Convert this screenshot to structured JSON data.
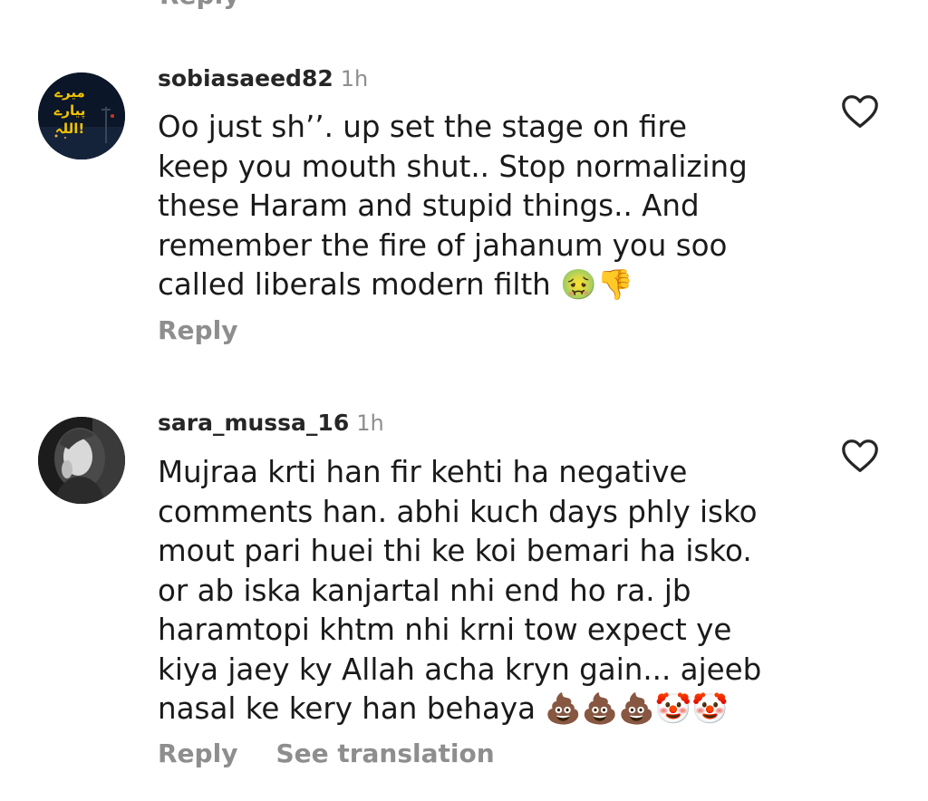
{
  "previous": {
    "reply_fragment": "Reply"
  },
  "comments": [
    {
      "username": "sobiasaeed82",
      "time": "1h",
      "avatar_text": "میرے پیارے اللہ!",
      "text_lines": [
        "Oo just sh’’. up set the stage on fire",
        "keep you mouth shut.. Stop normalizing",
        "these Haram and stupid things.. And",
        "remember the fire of jahanum you soo",
        "called liberals modern filth 🤢👎"
      ],
      "reply_label": "Reply",
      "like_icon": "heart-outline-icon"
    },
    {
      "username": "sara_mussa_16",
      "time": "1h",
      "text_lines": [
        "Mujraa krti han fir kehti ha negative",
        "comments han. abhi kuch days phly isko",
        "mout pari huei thi ke koi bemari ha isko.",
        "or ab iska kanjartal nhi end ho ra. jb",
        "haramtopi khtm nhi krni tow expect ye",
        "kiya jaey ky Allah acha kryn gain... ajeeb",
        "nasal ke kery han behaya 💩💩💩🤡🤡"
      ],
      "reply_label": "Reply",
      "translate_label": "See translation",
      "like_icon": "heart-outline-icon"
    }
  ],
  "colors": {
    "text": "#1a1a1a",
    "username": "#262626",
    "muted": "#8e8e8e",
    "avatar1_bg": "#0d1a2e",
    "avatar1_text": "#f2c200"
  }
}
